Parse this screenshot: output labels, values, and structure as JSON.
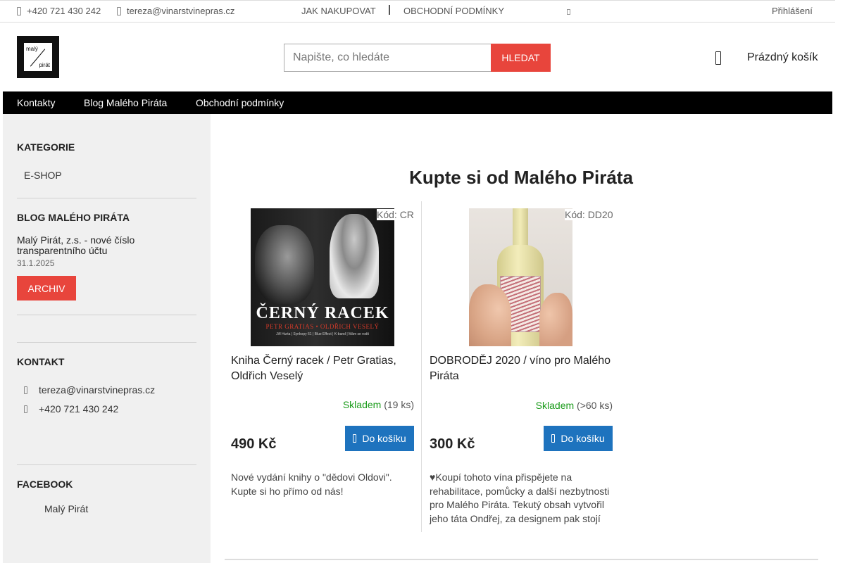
{
  "topbar": {
    "phone": "+420 721 430 242",
    "email": "tereza@vinarstvinepras.cz",
    "links": [
      "JAK NAKUPOVAT",
      "OBCHODNÍ PODMÍNKY"
    ],
    "login": "Přihlášení"
  },
  "header": {
    "logo": {
      "line1": "malý",
      "line2": "pirát"
    },
    "search": {
      "placeholder": "Napište, co hledáte",
      "button": "HLEDAT"
    },
    "cart": {
      "label": "Prázdný košík",
      "icon": "cart-icon"
    }
  },
  "nav": {
    "items": [
      "Kontakty",
      "Blog Malého Piráta",
      "Obchodní podmínky"
    ]
  },
  "sidebar": {
    "categories": {
      "heading": "KATEGORIE",
      "items": [
        "E-SHOP"
      ]
    },
    "blog": {
      "heading": "BLOG MALÉHO PIRÁTA",
      "post_title": "Malý Pirát, z.s. - nové číslo transparentního účtu",
      "post_date": "31.1.2025",
      "archive_button": "ARCHIV"
    },
    "contact": {
      "heading": "KONTAKT",
      "email": "tereza@vinarstvinepras.cz",
      "phone": "+420 721 430 242"
    },
    "facebook": {
      "heading": "FACEBOOK",
      "page": "Malý Pirát"
    }
  },
  "main": {
    "title": "Kupte si od Malého Piráta",
    "products": [
      {
        "code": "Kód: CR",
        "name": "Kniha Černý racek / Petr Gratias, Oldřich Veselý",
        "stock_label": "Skladem",
        "stock_count": "(19 ks)",
        "price": "490 Kč",
        "button": "Do košíku",
        "description": "Nové vydání knihy o \"dědovi Oldovi\". Kupte si ho přímo od nás!",
        "image": {
          "title": "ČERNÝ RACEK",
          "subtitle": "PETR GRATIAS • OLDŘICH VESELÝ",
          "fine": "Jiří Hurta | Synkopy 61 | Blue Effect | K-band | Mám se rodit"
        }
      },
      {
        "code": "Kód: DD20",
        "name": "DOBRODĚJ 2020 / víno pro Malého Piráta",
        "stock_label": "Skladem",
        "stock_count": "(>60 ks)",
        "price": "300 Kč",
        "button": "Do košíku",
        "description": "♥Koupí tohoto vína přispějete na rehabilitace, pomůcky a další nezbytnosti pro Malého Piráta. Tekutý obsah vytvořil jeho táta Ondřej, za designem pak stojí"
      }
    ]
  },
  "colors": {
    "accent_red": "#e8453c",
    "button_blue": "#1e73be",
    "stock_green": "#1a9b1a",
    "nav_black": "#000000"
  }
}
